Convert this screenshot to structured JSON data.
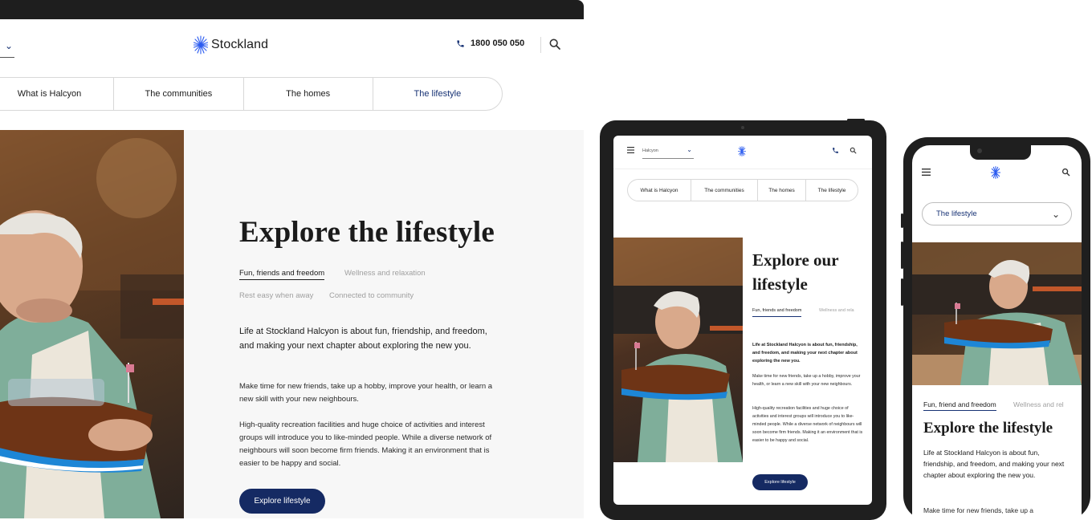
{
  "brand": {
    "name": "Stockland",
    "accent": "#152a63",
    "logo_color": "#2c5cf0"
  },
  "desktop": {
    "phone": "1800 050 050",
    "tabs": [
      "What is Halcyon",
      "The communities",
      "The homes",
      "The lifestyle"
    ],
    "title": "Explore the lifestyle",
    "subtabs": [
      "Fun, friends and freedom",
      "Wellness and relaxation",
      "Rest easy when away",
      "Connected to community"
    ],
    "lead": "Life at Stockland Halcyon is about fun, friendship, and freedom, and making your next chapter about exploring the new you.",
    "paragraphs": [
      "Make time for new friends, take up a hobby, improve your health, or learn a new skill with your new neighbours.",
      "High-quality recreation facilities and huge choice of activities and interest groups will introduce you to like-minded people. While a diverse network of neighbours will soon become firm friends. Making it an environment that is easier to be happy and social."
    ],
    "cta": "Explore lifestyle"
  },
  "tablet": {
    "community_select": "Halcyon",
    "tabs": [
      "What is Halcyon",
      "The communities",
      "The homes",
      "The lifestyle"
    ],
    "title": "Explore our lifestyle",
    "subtabs": [
      "Fun, friends and freedom",
      "Wellness and rela"
    ],
    "lead": "Life at Stockland Halcyon is about fun, friendship, and freedom, and making your next chapter about exploring the new you.",
    "paragraphs": [
      "Make time for new friends, take up a hobby, improve your health, or learn a new skill with your new neighbours.",
      "High-quality recreation facilities and huge choice of activities and interest groups will introduce you to like-minded people. While a diverse network of neighbours will soon become firm friends. Making it an environment that is easier to be happy and social."
    ],
    "cta": "Explore lifestyle"
  },
  "mobile": {
    "section_select": "The lifestyle",
    "subtabs": [
      "Fun, friend and freedom",
      "Wellness and rel"
    ],
    "title": "Explore the lifestyle",
    "lead": "Life at Stockland Halcyon is about fun, friendship, and freedom, and making your next chapter about exploring the new you.",
    "paragraph_partial": "Make time for new friends, take up a"
  }
}
